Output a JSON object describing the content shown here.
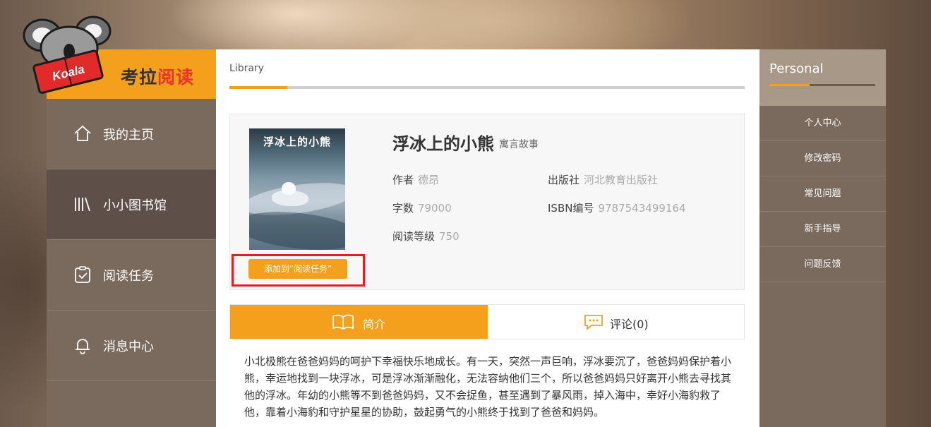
{
  "app": {
    "logo_brand": "Koala",
    "logo_prefix": "考拉",
    "logo_accent": "阅读",
    "accent_color": "#f5a01c",
    "highlight_color": "#e01f1f"
  },
  "left_nav": {
    "items": [
      {
        "label": "我的主页",
        "icon": "home-icon"
      },
      {
        "label": "小小图书馆",
        "icon": "library-icon",
        "active": true
      },
      {
        "label": "阅读任务",
        "icon": "task-clipboard-icon"
      },
      {
        "label": "消息中心",
        "icon": "bell-icon"
      }
    ]
  },
  "main": {
    "breadcrumb": "Library",
    "book": {
      "cover_title": "浮冰上的小熊",
      "title": "浮冰上的小熊",
      "genre": "寓言故事",
      "author_label": "作者",
      "author": "德昂",
      "publisher_label": "出版社",
      "publisher": "河北教育出版社",
      "word_count_label": "字数",
      "word_count": "79000",
      "isbn_label": "ISBN编号",
      "isbn": "9787543499164",
      "level_label": "阅读等级",
      "level": "750",
      "add_button": "添加到“阅读任务”"
    },
    "tabs": {
      "intro_label": "简介",
      "comments_label": "评论(0)"
    },
    "summary": "小北极熊在爸爸妈妈的呵护下幸福快乐地成长。有一天，突然一声巨响，浮冰要沉了，爸爸妈妈保护着小熊，幸运地找到一块浮冰，可是浮冰渐渐融化，无法容纳他们三个，所以爸爸妈妈只好离开小熊去寻找其他的浮冰。年幼的小熊等不到爸爸妈妈，又不会捉鱼，甚至遇到了暴风雨，掉入海中，幸好小海豹救了他，靠着小海豹和守护星星的协助，鼓起勇气的小熊终于找到了爸爸和妈妈。"
  },
  "right_panel": {
    "title": "Personal",
    "items": [
      "个人中心",
      "修改密码",
      "常见问题",
      "新手指导",
      "问题反馈"
    ]
  }
}
